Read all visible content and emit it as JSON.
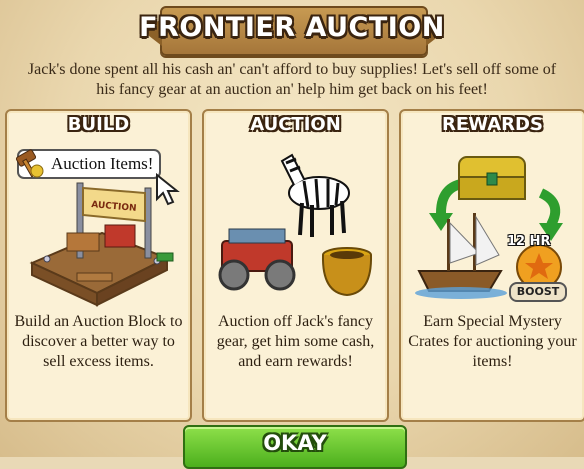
{
  "dialog": {
    "title": "FRONTIER AUCTION",
    "intro": "Jack's done spent all his cash an' can't afford to buy supplies! Let's sell off some of his fancy gear at an auction an' help him get back on his feet!"
  },
  "panels": [
    {
      "title": "BUILD",
      "tooltip": "Auction Items!",
      "sign_text": "AUCTION",
      "text": "Build an Auction Block to discover a better way to sell excess items."
    },
    {
      "title": "AUCTION",
      "text": "Auction off Jack's fancy gear, get him some cash, and earn rewards!"
    },
    {
      "title": "REWARDS",
      "timer": "12 HR",
      "boost_label": "BOOST",
      "text": "Earn Special Mystery Crates for auctioning your items!"
    }
  ],
  "actions": {
    "okay_label": "OKAY"
  },
  "icons": {
    "gavel": "gavel-icon",
    "cursor": "hand-cursor-icon",
    "boost": "star-badge-icon"
  },
  "colors": {
    "okay_button": "#5cc323",
    "parchment": "#f4e7c6",
    "panel_border": "#a47f48"
  }
}
